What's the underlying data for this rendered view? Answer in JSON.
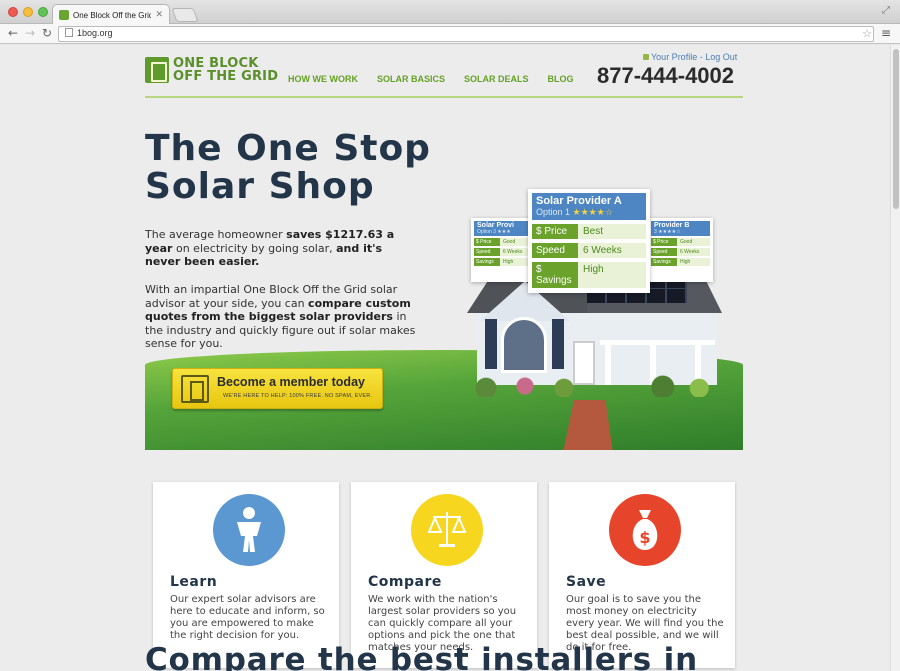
{
  "browser": {
    "tab_title": "One Block Off the Grid",
    "url": "1bog.org"
  },
  "header": {
    "logo_line1": "ONE BLOCK",
    "logo_line2": "OFF THE GRID",
    "nav": [
      "HOW WE WORK",
      "SOLAR BASICS",
      "SOLAR DEALS",
      "BLOG"
    ],
    "account": "Your Profile - Log Out",
    "phone": "877-444-4002"
  },
  "hero": {
    "title": "The One Stop Solar Shop",
    "p1_plain": "The average homeowner ",
    "p1_bold1": "saves $1217.63 a year",
    "p1_plain2": " on electricity by going solar, ",
    "p1_bold2": "and it's never been easier.",
    "p2_plain": "With an impartial One Block Off the Grid solar advisor at your side, you can ",
    "p2_bold": "compare custom quotes from the biggest solar providers",
    "p2_plain2": " in the industry and quickly figure out if solar makes sense for you.",
    "cta_title": "Become a member today",
    "cta_sub": "WE'RE HERE TO HELP: 100% FREE. NO SPAM, EVER."
  },
  "providers": {
    "main": {
      "name": "Solar Provider A",
      "option": "Option 1",
      "stars": "★★★★☆",
      "rows": [
        {
          "label": "$ Price",
          "value": "Best"
        },
        {
          "label": "Speed",
          "value": "6 Weeks"
        },
        {
          "label": "$ Savings",
          "value": "High"
        }
      ]
    },
    "left": {
      "name": "Solar Provi",
      "option": "Option 3 ★★★",
      "rows": [
        {
          "label": "$ Price",
          "value": "Good"
        },
        {
          "label": "Speed",
          "value": "6 Weeks"
        },
        {
          "label": "Savings",
          "value": "High"
        }
      ]
    },
    "right": {
      "name": "Provider B",
      "option": "3 ★★★★☆",
      "rows": [
        {
          "label": "$ Price",
          "value": "Good"
        },
        {
          "label": "Speed",
          "value": "6 Weeks"
        },
        {
          "label": "Savings",
          "value": "High"
        }
      ]
    }
  },
  "features": [
    {
      "title": "Learn",
      "text": "Our expert solar advisors are here to educate and inform, so you are empowered to make the right decision for you.",
      "icon": "person-icon",
      "color": "#5b97d0"
    },
    {
      "title": "Compare",
      "text": "We work with the nation's largest solar providers so you can quickly compare all your options and pick the one that matches your needs.",
      "icon": "scales-icon",
      "color": "#f6d61e"
    },
    {
      "title": "Save",
      "text": "Our goal is to save you the most money on electricity every year. We will find you the best deal possible, and we will do it for free.",
      "icon": "money-bag-icon",
      "color": "#e7452b"
    }
  ],
  "bottom_title": "Compare the best installers in"
}
